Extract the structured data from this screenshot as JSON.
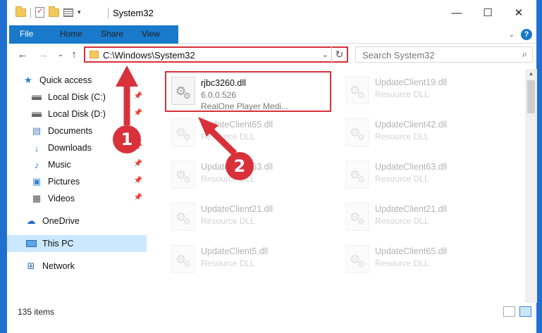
{
  "window": {
    "title": "System32",
    "controls": {
      "minimize": "—",
      "maximize": "☐",
      "close": "✕"
    }
  },
  "ribbon": {
    "tabs": [
      {
        "label": "File"
      },
      {
        "label": "Home"
      },
      {
        "label": "Share"
      },
      {
        "label": "View"
      }
    ],
    "help_label": "?"
  },
  "address": {
    "path": "C:\\Windows\\System32",
    "search_placeholder": "Search System32"
  },
  "sidebar": {
    "items": [
      {
        "label": "Quick access",
        "icon": "star-icon",
        "pinned": false
      },
      {
        "label": "Local Disk (C:)",
        "icon": "drive-icon",
        "pinned": true
      },
      {
        "label": "Local Disk (D:)",
        "icon": "drive-icon",
        "pinned": true
      },
      {
        "label": "Documents",
        "icon": "documents-icon",
        "pinned": true
      },
      {
        "label": "Downloads",
        "icon": "download-icon",
        "pinned": true
      },
      {
        "label": "Music",
        "icon": "music-icon",
        "pinned": true
      },
      {
        "label": "Pictures",
        "icon": "pictures-icon",
        "pinned": true
      },
      {
        "label": "Videos",
        "icon": "videos-icon",
        "pinned": true
      },
      {
        "label": "OneDrive",
        "icon": "onedrive-icon",
        "pinned": false
      },
      {
        "label": "This PC",
        "icon": "computer-icon",
        "pinned": false,
        "selected": true
      },
      {
        "label": "Network",
        "icon": "network-icon",
        "pinned": false
      }
    ]
  },
  "files": {
    "selected": {
      "name": "rjbc3260.dll",
      "version": "6.0.0.526",
      "description": "RealOne Player Medi..."
    },
    "left_column": [
      {
        "name": "UpdateClient65.dll",
        "type": "Resource DLL"
      },
      {
        "name": "UpdateClient63.dll",
        "type": "Resource DLL"
      },
      {
        "name": "UpdateClient21.dll",
        "type": "Resource DLL"
      },
      {
        "name": "UpdateClient5.dll",
        "type": "Resource DLL"
      }
    ],
    "right_column": [
      {
        "name": "UpdateClient19.dll",
        "type": "Resource DLL"
      },
      {
        "name": "UpdateClient42.dll",
        "type": "Resource DLL"
      },
      {
        "name": "UpdateClient63.dll",
        "type": "Resource DLL"
      },
      {
        "name": "UpdateClient21.dll",
        "type": "Resource DLL"
      },
      {
        "name": "UpdateClient65.dll",
        "type": "Resource DLL"
      }
    ]
  },
  "status": {
    "item_count": "135 items"
  },
  "annotations": {
    "step1": "1",
    "step2": "2",
    "color": "#d8313a"
  }
}
